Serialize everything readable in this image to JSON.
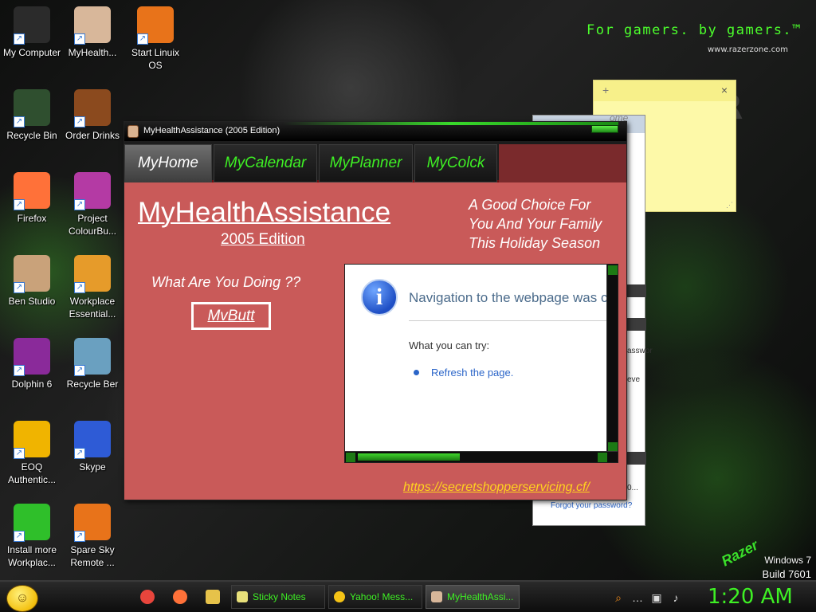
{
  "desktop": {
    "brand_slogan": "For gamers. by gamers.™",
    "brand_url": "www.razerzone.com",
    "brand_bg_text": "R",
    "razer_logo": "Razer",
    "windows_version": "Windows 7",
    "windows_build": "Build 7601",
    "icons": [
      {
        "label": "My Computer",
        "icon": "computer-icon",
        "color": "#2b2b2b"
      },
      {
        "label": "MyHealth...",
        "icon": "person-avatar-icon",
        "color": "#d8b79a"
      },
      {
        "label": "Start Linuix OS",
        "icon": "laptop-icon",
        "color": "#e8731a"
      },
      {
        "label": "Recycle Bin",
        "icon": "recycle-bin-icon",
        "color": "#2f4f2f"
      },
      {
        "label": "Order Drinks",
        "icon": "coffee-bean-icon",
        "color": "#8b4a1e"
      },
      {
        "label": "Firefox",
        "icon": "firefox-icon",
        "color": "#ff7139"
      },
      {
        "label": "Project ColourBu...",
        "icon": "collage-icon",
        "color": "#b43aa4"
      },
      {
        "label": "Ben Studio",
        "icon": "dog-icon",
        "color": "#c9a27a"
      },
      {
        "label": "Workplace Essential...",
        "icon": "folder-icon",
        "color": "#e69b2a"
      },
      {
        "label": "Dolphin 6",
        "icon": "dolphin-icon",
        "color": "#8a2a9a"
      },
      {
        "label": "Recycle Ber",
        "icon": "photo-face-icon",
        "color": "#6aa0c0"
      },
      {
        "label": "EOQ Authentic...",
        "icon": "key-icon",
        "color": "#f0b400"
      },
      {
        "label": "Skype",
        "icon": "window-app-icon",
        "color": "#2e5bd6"
      },
      {
        "label": "Install more Workplac...",
        "icon": "download-arrow-icon",
        "color": "#2fbf2a"
      },
      {
        "label": "Spare Sky Remote ...",
        "icon": "laptop-icon",
        "color": "#e8731a"
      }
    ]
  },
  "sticky_note": {
    "add": "+",
    "close": "×",
    "ghost_text": "ome"
  },
  "background_window": {
    "fragments": [
      "asswor",
      "eve",
      "0..."
    ],
    "forgot_link": "Forgot your password?"
  },
  "main_window": {
    "title": "MyHealthAssistance (2005 Edition)",
    "tabs": [
      "MyHome",
      "MyCalendar",
      "MyPlanner",
      "MyColck"
    ],
    "app_title": "MyHealthAssistance",
    "edition": "2005 Edition",
    "tagline": [
      "A Good Choice For",
      "You And Your Family",
      "This Holiday Season"
    ],
    "question": "What Are You Doing ??",
    "button_label": "MvButt",
    "webpage": {
      "heading": "Navigation to the webpage was canceled",
      "what_you_can_try": "What you can try:",
      "refresh": "Refresh the page.",
      "info_glyph": "i"
    },
    "link": "https://secretshopperservicing.cf/"
  },
  "taskbar": {
    "start_glyph": "☺",
    "quick_launch": [
      {
        "icon": "chrome-icon",
        "color": "#e8453c"
      },
      {
        "icon": "firefox-icon",
        "color": "#ff7139"
      },
      {
        "icon": "folder-icon",
        "color": "#e6c24a"
      }
    ],
    "tasks": [
      "Sticky Notes",
      "Yahoo! Mess...",
      "MyHealthAssi..."
    ],
    "tray": [
      "⌕",
      "…",
      "▣",
      "♪"
    ],
    "clock": "1:20 AM"
  }
}
